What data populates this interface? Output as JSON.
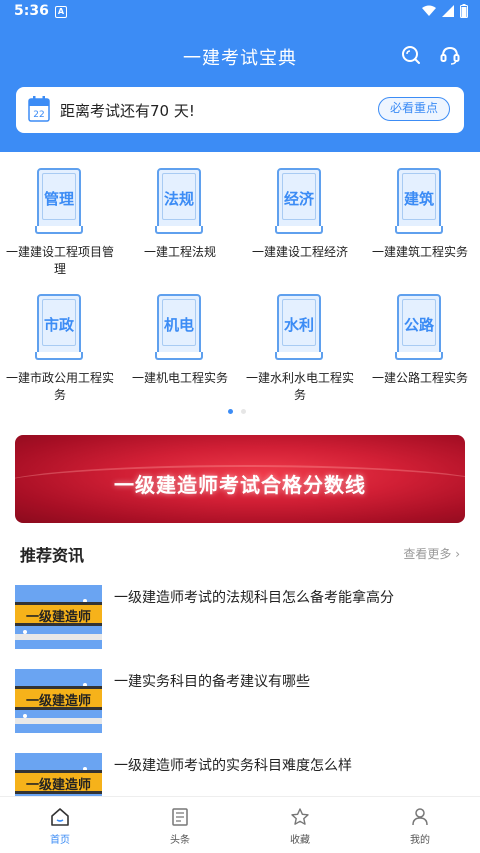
{
  "status_bar": {
    "time": "5:36",
    "notification_icon": "A"
  },
  "header": {
    "title": "一建考试宝典"
  },
  "countdown": {
    "text": "距离考试还有70 天!",
    "calendar_day": "22",
    "button": "必看重点"
  },
  "categories": [
    {
      "label": "管理",
      "name": "一建建设工程项目管理"
    },
    {
      "label": "法规",
      "name": "一建工程法规"
    },
    {
      "label": "经济",
      "name": "一建建设工程经济"
    },
    {
      "label": "建筑",
      "name": "一建建筑工程实务"
    },
    {
      "label": "市政",
      "name": "一建市政公用工程实务"
    },
    {
      "label": "机电",
      "name": "一建机电工程实务"
    },
    {
      "label": "水利",
      "name": "一建水利水电工程实务"
    },
    {
      "label": "公路",
      "name": "一建公路工程实务"
    }
  ],
  "banner": {
    "text": "一级建造师考试合格分数线"
  },
  "news_section": {
    "title": "推荐资讯",
    "more": "查看更多"
  },
  "news": [
    {
      "thumb_text": "一级建造师",
      "title": "一级建造师考试的法规科目怎么备考能拿高分"
    },
    {
      "thumb_text": "一级建造师",
      "title": "一建实务科目的备考建议有哪些"
    },
    {
      "thumb_text": "一级建造师",
      "title": "一级建造师考试的实务科目难度怎么样"
    }
  ],
  "tabs": [
    {
      "label": "首页",
      "icon": "home-icon"
    },
    {
      "label": "头条",
      "icon": "news-icon"
    },
    {
      "label": "收藏",
      "icon": "star-icon"
    },
    {
      "label": "我的",
      "icon": "person-icon"
    }
  ],
  "colors": {
    "primary": "#3c8cf5",
    "banner": "#d11f35",
    "thumb_bg": "#6aa4f2",
    "plank": "#f6b21a"
  }
}
